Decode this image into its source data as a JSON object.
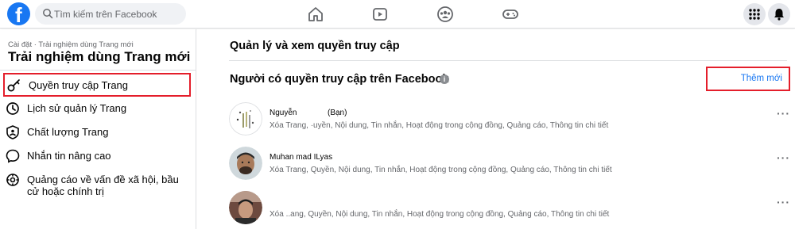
{
  "header": {
    "logo": "f",
    "search_placeholder": "Tìm kiếm trên Facebook",
    "nav_icons": [
      "home-icon",
      "watch-icon",
      "groups-icon",
      "gaming-icon"
    ],
    "right_icons": [
      "menu-grid-icon",
      "notifications-bell-icon"
    ]
  },
  "sidebar": {
    "breadcrumb": "Cài đặt · Trải nghiệm dùng Trang mới",
    "title": "Trải nghiệm dùng Trang mới",
    "items": [
      {
        "label": "Quyền truy cập Trang",
        "icon": "key-icon",
        "active": true
      },
      {
        "label": "Lịch sử quản lý Trang",
        "icon": "history-icon"
      },
      {
        "label": "Chất lượng Trang",
        "icon": "shield-icon"
      },
      {
        "label": "Nhắn tin nâng cao",
        "icon": "messenger-icon"
      },
      {
        "label": "Quảng cáo về vấn đề xã hội, bầu cử hoặc chính trị",
        "icon": "ad-gear-icon"
      }
    ]
  },
  "main": {
    "title": "Quản lý và xem quyền truy cập",
    "section_title": "Người có quyền truy cập trên Facebook",
    "info_icon": "i",
    "add_button": "Thêm mới",
    "more_label": "···",
    "people": [
      {
        "name": "Nguyễn",
        "tag": "(Bạn)",
        "permissions": "Xóa Trang, ·uyền, Nội dung, Tin nhắn, Hoạt động trong cộng đồng, Quảng cáo, Thông tin chi tiết"
      },
      {
        "name": "Muhan mad ILyas",
        "tag": "",
        "permissions": "Xóa Trang, Quyền, Nội dung, Tin nhắn, Hoạt động trong cộng đồng, Quảng cáo, Thông tin chi tiết"
      },
      {
        "name": "",
        "tag": "",
        "permissions": "Xóa ..ang, Quyền, Nội dung, Tin nhắn, Hoạt động trong cộng đồng, Quảng cáo, Thông tin chi tiết"
      }
    ]
  },
  "colors": {
    "brand": "#1877f2",
    "highlight": "#e41e2b"
  }
}
